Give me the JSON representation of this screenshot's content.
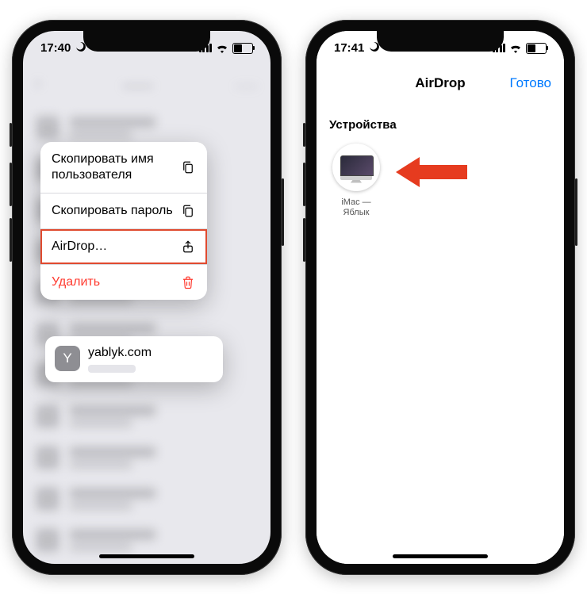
{
  "watermark": "Яблык",
  "phone1": {
    "time": "17:40",
    "context_menu": {
      "copy_username": "Скопировать имя пользователя",
      "copy_password": "Скопировать пароль",
      "airdrop": "AirDrop…",
      "delete": "Удалить"
    },
    "preview": {
      "avatar_letter": "Y",
      "title": "yablyk.com"
    }
  },
  "phone2": {
    "time": "17:41",
    "nav_title": "AirDrop",
    "done": "Готово",
    "section": "Устройства",
    "device_name": "iMac — Яблык"
  }
}
